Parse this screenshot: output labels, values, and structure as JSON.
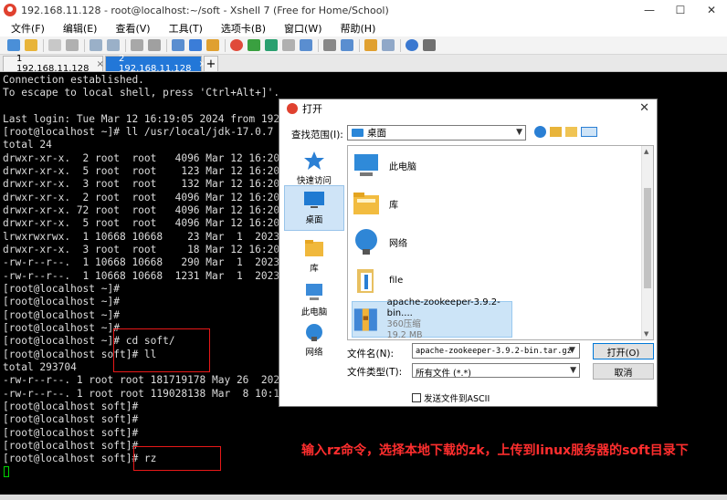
{
  "window": {
    "title": "192.168.11.128 - root@localhost:~/soft - Xshell 7 (Free for Home/School)",
    "min": "—",
    "max": "☐",
    "close": "✕"
  },
  "menu": [
    "文件(F)",
    "编辑(E)",
    "查看(V)",
    "工具(T)",
    "选项卡(B)",
    "窗口(W)",
    "帮助(H)"
  ],
  "tabs": [
    {
      "label": "1 192.168.11.128",
      "close": "×",
      "active": false
    },
    {
      "label": "2 192.168.11.128",
      "close": "×",
      "active": true
    }
  ],
  "tab_add": "+",
  "terminal": {
    "lines": [
      "Connection established.",
      "To escape to local shell, press 'Ctrl+Alt+]'.",
      "",
      "Last login: Tue Mar 12 16:19:05 2024 from 192",
      "[root@localhost ~]# ll /usr/local/jdk-17.0.7",
      "total 24",
      "drwxr-xr-x.  2 root  root   4096 Mar 12 16:20",
      "drwxr-xr-x.  5 root  root    123 Mar 12 16:20",
      "drwxr-xr-x.  3 root  root    132 Mar 12 16:20",
      "drwxr-xr-x.  2 root  root   4096 Mar 12 16:20",
      "drwxr-xr-x. 72 root  root   4096 Mar 12 16:20",
      "drwxr-xr-x.  5 root  root   4096 Mar 12 16:20",
      "lrwxrwxrwx.  1 10668 10668    23 Mar  1  2023",
      "drwxr-xr-x.  3 root  root     18 Mar 12 16:20",
      "-rw-r--r--.  1 10668 10668   290 Mar  1  2023",
      "-rw-r--r--.  1 10668 10668  1231 Mar  1  2023",
      "[root@localhost ~]#",
      "[root@localhost ~]#",
      "[root@localhost ~]#",
      "[root@localhost ~]#",
      "[root@localhost ~]# cd soft/",
      "[root@localhost soft]# ll",
      "total 293704",
      "-rw-r--r--. 1 root root 181719178 May 26  202",
      "-rw-r--r--. 1 root root 119028138 Mar  8 10:1",
      "[root@localhost soft]#",
      "[root@localhost soft]#",
      "[root@localhost soft]#",
      "[root@localhost soft]#",
      "[root@localhost soft]# rz"
    ]
  },
  "annotation": "输入rz命令，选择本地下载的zk，上传到linux服务器的soft目录下",
  "dialog": {
    "title": "打开",
    "close": "✕",
    "lookin_label": "查找范围(I):",
    "lookin_value": "桌面",
    "places": [
      "快速访问",
      "桌面",
      "库",
      "此电脑",
      "网络"
    ],
    "files": [
      {
        "name": "此电脑"
      },
      {
        "name": "库"
      },
      {
        "name": "网络"
      },
      {
        "name": "file"
      },
      {
        "name": "apache-zookeeper-3.9.2-bin....",
        "type": "360压缩",
        "size": "19.2 MB"
      }
    ],
    "filename_label": "文件名(N):",
    "filename_value": "apache-zookeeper-3.9.2-bin.tar.gz",
    "filetype_label": "文件类型(T):",
    "filetype_value": "所有文件 (*.*)",
    "open_button": "打开(O)",
    "cancel_button": "取消",
    "ascii_label": "发送文件到ASCII"
  },
  "colors": {
    "terminal_bg": "#000000",
    "terminal_fg": "#dcdcdc",
    "active_tab": "#2277d8",
    "annotation": "#ff2e2e",
    "highlight_box": "#e81818",
    "cursor": "#00d200"
  }
}
